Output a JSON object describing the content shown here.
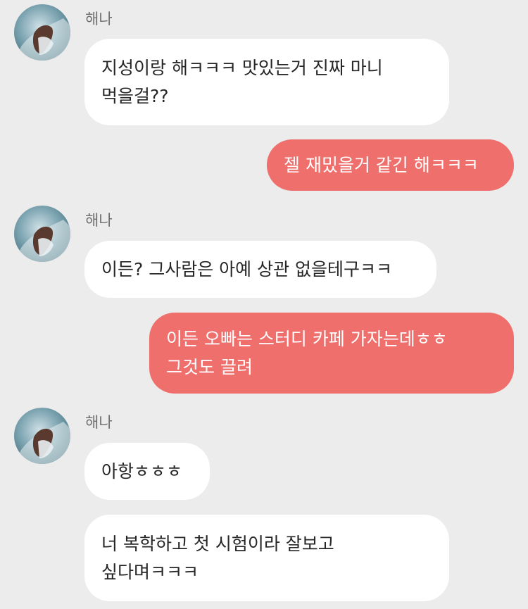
{
  "colors": {
    "background": "#ececec",
    "incoming_bubble": "#ffffff",
    "outgoing_bubble": "#ee6f6c",
    "incoming_text": "#262626",
    "outgoing_text": "#ffffff",
    "sender_name": "#6e6e6e"
  },
  "messages": [
    {
      "sender": "해나",
      "avatar": "profile-avatar",
      "text": "지성이랑 해ㅋㅋㅋ 맛있는거 진짜 마니 먹을걸??"
    },
    {
      "sender": "me",
      "text": "젤 재밌을거 같긴 해ㅋㅋㅋ"
    },
    {
      "sender": "해나",
      "avatar": "profile-avatar",
      "text": "이든? 그사람은 아예 상관 없을테구ㅋㅋ"
    },
    {
      "sender": "me",
      "text": "이든 오빠는 스터디 카페 가자는데ㅎㅎ 그것도 끌려"
    },
    {
      "sender": "해나",
      "avatar": "profile-avatar",
      "text": "아항ㅎㅎㅎ"
    },
    {
      "sender": "해나",
      "text": "너 복학하고 첫 시험이라 잘보고 싶다며ㅋㅋㅋ"
    }
  ]
}
